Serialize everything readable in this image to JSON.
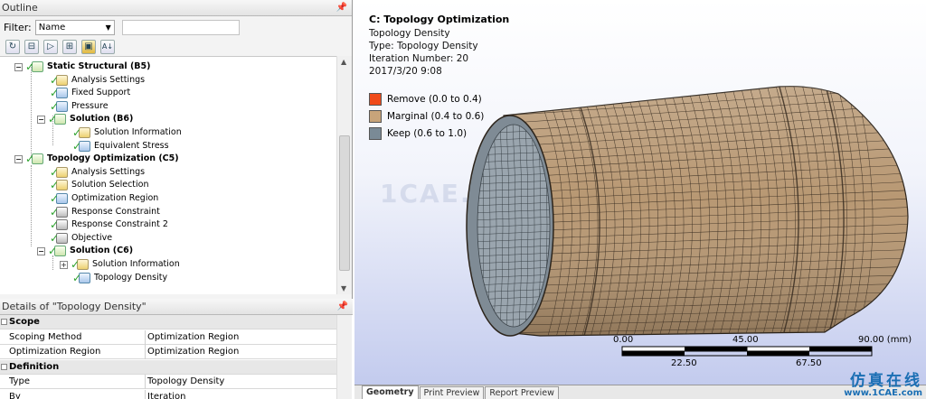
{
  "outline": {
    "title": "Outline",
    "pin": "ᵖ",
    "filter_label": "Filter:",
    "filter_value": "Name",
    "toolbar_icons": [
      "refresh-icon",
      "expand-tree-icon",
      "collapse-tree-icon",
      "expand-all-icon",
      "folder-icon",
      "sort-icon"
    ],
    "tree": [
      {
        "label": "Static Structural (B5)",
        "bold": true
      },
      {
        "label": "Analysis Settings"
      },
      {
        "label": "Fixed Support"
      },
      {
        "label": "Pressure"
      },
      {
        "label": "Solution (B6)",
        "bold": true
      },
      {
        "label": "Solution Information"
      },
      {
        "label": "Equivalent Stress"
      },
      {
        "label": "Topology Optimization (C5)",
        "bold": true
      },
      {
        "label": "Analysis Settings"
      },
      {
        "label": "Solution Selection"
      },
      {
        "label": "Optimization Region"
      },
      {
        "label": "Response Constraint"
      },
      {
        "label": "Response Constraint 2"
      },
      {
        "label": "Objective"
      },
      {
        "label": "Solution (C6)",
        "bold": true
      },
      {
        "label": "Solution Information"
      },
      {
        "label": "Topology Density"
      }
    ]
  },
  "details": {
    "title": "Details of \"Topology Density\"",
    "groups": [
      {
        "name": "Scope",
        "rows": [
          {
            "key": "Scoping Method",
            "value": "Optimization Region"
          },
          {
            "key": "Optimization Region",
            "value": "Optimization Region"
          }
        ]
      },
      {
        "name": "Definition",
        "rows": [
          {
            "key": "Type",
            "value": "Topology Density"
          },
          {
            "key": "By",
            "value": "Iteration"
          }
        ]
      }
    ]
  },
  "viewport": {
    "title": "C: Topology Optimization",
    "lines": [
      "Topology Density",
      "Type: Topology Density",
      "Iteration Number: 20",
      "2017/3/20 9:08"
    ],
    "legend": [
      {
        "label": "Remove (0.0 to 0.4)",
        "color": "#f04a1a"
      },
      {
        "label": "Marginal (0.4 to 0.6)",
        "color": "#c8a47a"
      },
      {
        "label": "Keep (0.6 to 1.0)",
        "color": "#7a8a96"
      }
    ],
    "watermark": "1CAE.COM",
    "scale": {
      "top_labels": [
        "0.00",
        "45.00",
        "90.00 (mm)"
      ],
      "bottom_labels": [
        "22.50",
        "67.50"
      ]
    },
    "model_color": "#b89873",
    "mesh_color": "#3a2e22"
  },
  "tabs": [
    "Geometry",
    "Print Preview",
    "Report Preview"
  ],
  "logo": {
    "cn": "仿真在线",
    "en": "www.1CAE.com"
  }
}
